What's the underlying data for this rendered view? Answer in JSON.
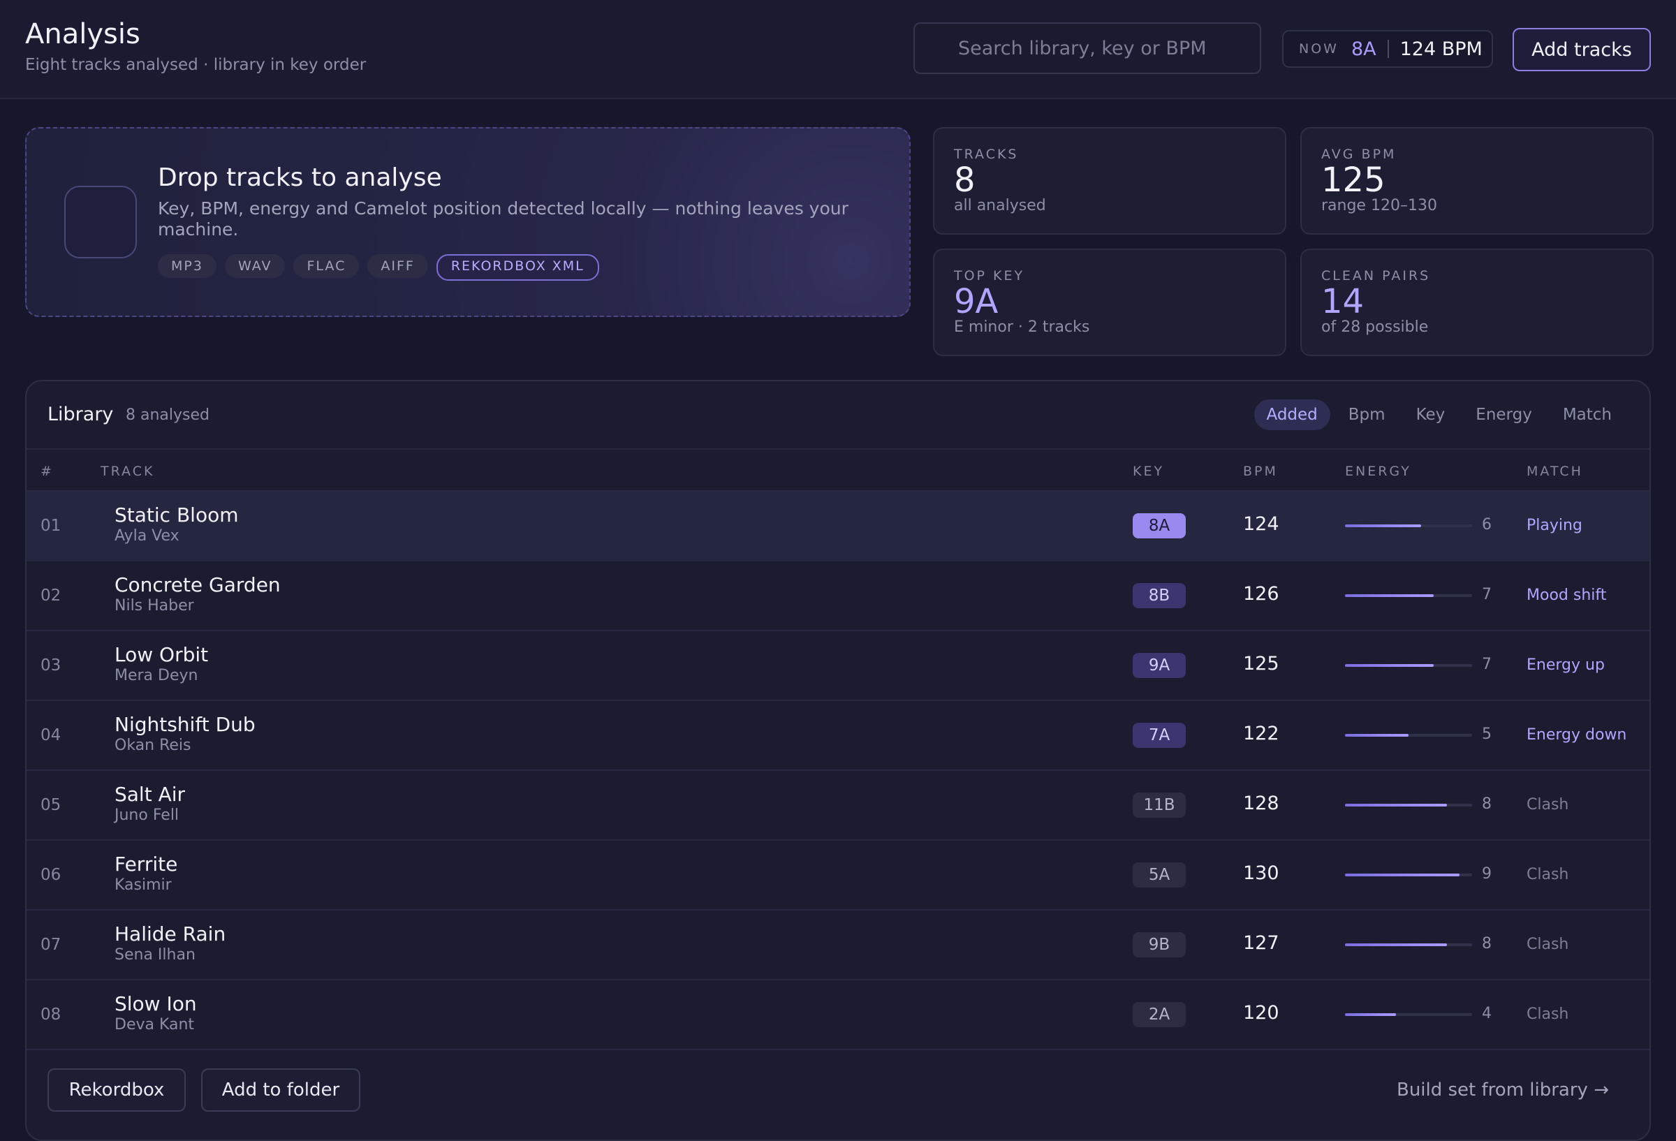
{
  "header": {
    "title": "Analysis",
    "subtitle": "Eight tracks analysed · library in key order",
    "search_placeholder": "Search library, key or BPM",
    "now_label": "NOW",
    "now_key": "8A",
    "now_bpm": "124 BPM",
    "add_tracks_label": "Add tracks"
  },
  "drop": {
    "title": "Drop tracks to analyse",
    "description": "Key, BPM, energy and Camelot position detected locally — nothing leaves your machine.",
    "formats": [
      "MP3",
      "WAV",
      "FLAC",
      "AIFF",
      "REKORDBOX XML"
    ]
  },
  "stats": [
    {
      "label": "TRACKS",
      "value": "8",
      "sub": "all analysed",
      "accent": false
    },
    {
      "label": "AVG BPM",
      "value": "125",
      "sub": "range 120–130",
      "accent": false
    },
    {
      "label": "TOP KEY",
      "value": "9A",
      "sub": "E minor · 2 tracks",
      "accent": true
    },
    {
      "label": "CLEAN PAIRS",
      "value": "14",
      "sub": "of 28 possible",
      "accent": true
    }
  ],
  "library": {
    "title": "Library",
    "count": "8 analysed",
    "sort_options": [
      "Added",
      "Bpm",
      "Key",
      "Energy",
      "Match"
    ],
    "active_sort": "Added",
    "columns": {
      "num": "#",
      "track": "TRACK",
      "key": "KEY",
      "bpm": "BPM",
      "energy": "ENERGY",
      "match": "MATCH"
    },
    "rows": [
      {
        "num": "01",
        "title": "Static Bloom",
        "artist": "Ayla Vex",
        "key": "8A",
        "bpm": "124",
        "energy": 6,
        "match": "Playing",
        "key_state": "active",
        "current": true
      },
      {
        "num": "02",
        "title": "Concrete Garden",
        "artist": "Nils Haber",
        "key": "8B",
        "bpm": "126",
        "energy": 7,
        "match": "Mood shift",
        "key_state": "compat",
        "current": false
      },
      {
        "num": "03",
        "title": "Low Orbit",
        "artist": "Mera Deyn",
        "key": "9A",
        "bpm": "125",
        "energy": 7,
        "match": "Energy up",
        "key_state": "compat",
        "current": false
      },
      {
        "num": "04",
        "title": "Nightshift Dub",
        "artist": "Okan Reis",
        "key": "7A",
        "bpm": "122",
        "energy": 5,
        "match": "Energy down",
        "key_state": "compat",
        "current": false
      },
      {
        "num": "05",
        "title": "Salt Air",
        "artist": "Juno Fell",
        "key": "11B",
        "bpm": "128",
        "energy": 8,
        "match": "Clash",
        "key_state": "clash",
        "current": false
      },
      {
        "num": "06",
        "title": "Ferrite",
        "artist": "Kasimir",
        "key": "5A",
        "bpm": "130",
        "energy": 9,
        "match": "Clash",
        "key_state": "clash",
        "current": false
      },
      {
        "num": "07",
        "title": "Halide Rain",
        "artist": "Sena Ilhan",
        "key": "9B",
        "bpm": "127",
        "energy": 8,
        "match": "Clash",
        "key_state": "clash",
        "current": false
      },
      {
        "num": "08",
        "title": "Slow Ion",
        "artist": "Deva Kant",
        "key": "2A",
        "bpm": "120",
        "energy": 4,
        "match": "Clash",
        "key_state": "clash",
        "current": false
      }
    ]
  },
  "footer": {
    "rekordbox_label": "Rekordbox",
    "add_folder_label": "Add to folder",
    "build_set_label": "Build set from library →"
  },
  "colors": {
    "accent": "#a89bff",
    "background": "#16172a",
    "panel": "#1b1c30",
    "key_active": "#9a8aef",
    "key_compatible": "#3b3570",
    "key_clash": "#2c2d40"
  }
}
